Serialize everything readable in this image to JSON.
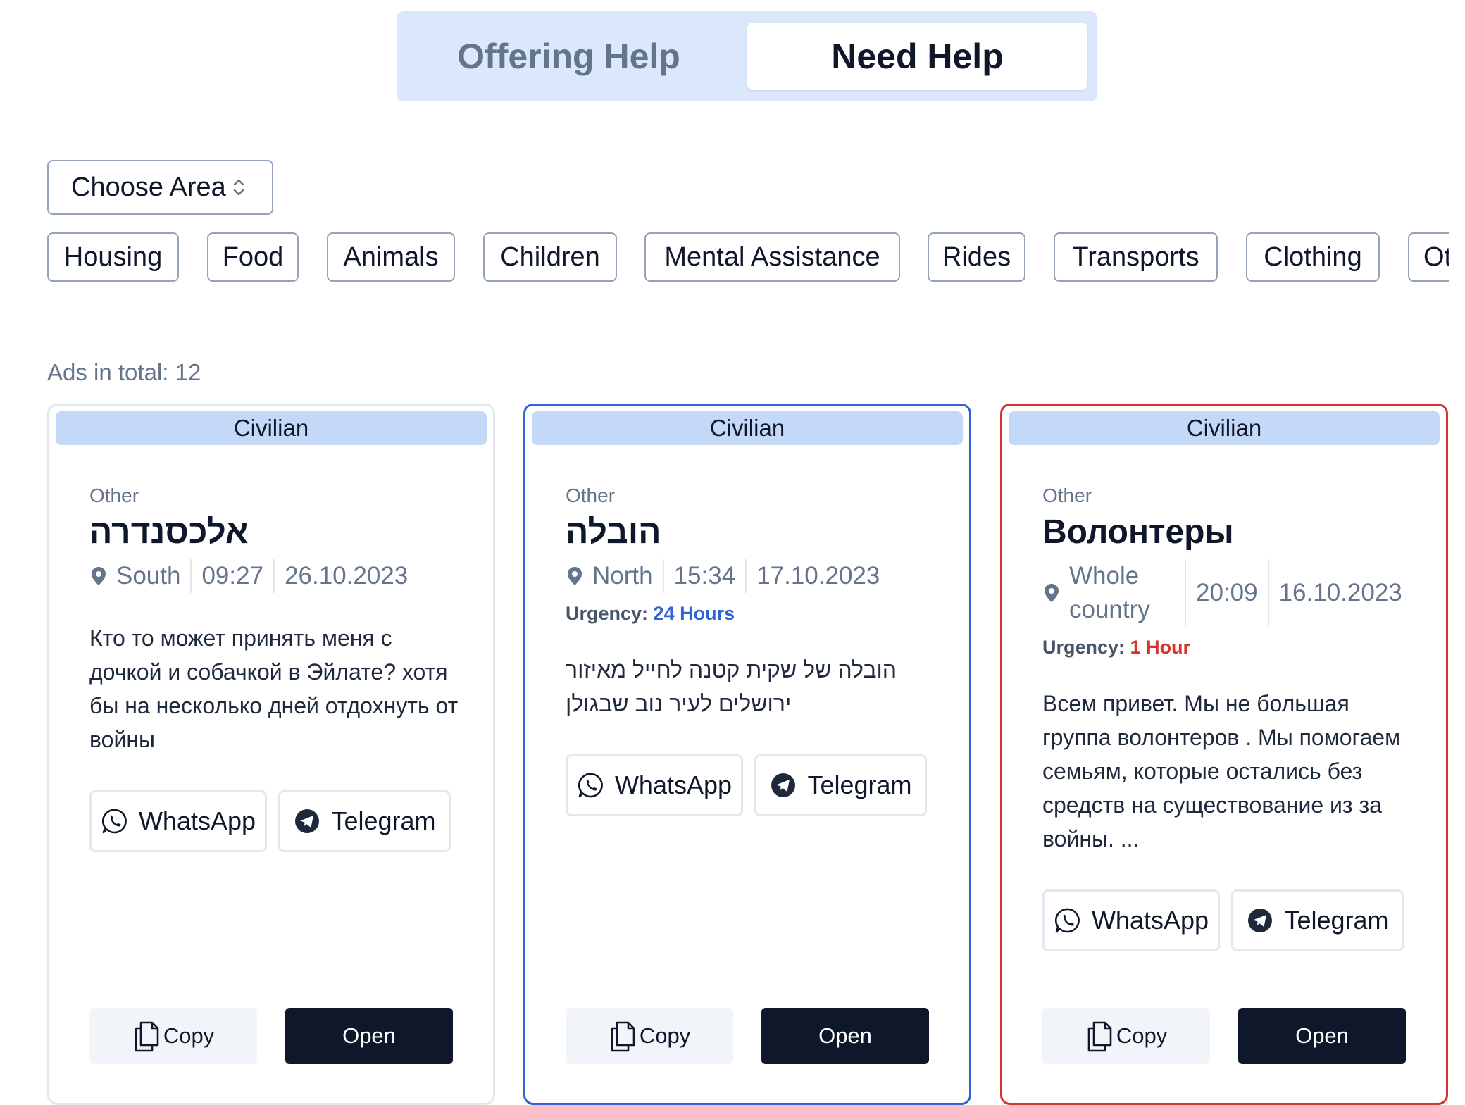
{
  "toggle": {
    "offering_label": "Offering Help",
    "need_label": "Need Help"
  },
  "area_select": {
    "label": "Choose Area"
  },
  "categories": [
    "Housing",
    "Food",
    "Animals",
    "Children",
    "Mental Assistance",
    "Rides",
    "Transports",
    "Clothing",
    "Ot"
  ],
  "ads_total": "Ads in total: 12",
  "cards": [
    {
      "type": "Civilian",
      "category": "Other",
      "title": "אלכסנדרה",
      "location": "South",
      "time": "09:27",
      "date": "26.10.2023",
      "urgency_label": "",
      "urgency_value": "",
      "description": "Кто то может принять меня с дочкой и собачкой в Эйлате? хотя бы на несколько дней отдохнуть от войны",
      "whatsapp": "WhatsApp",
      "telegram": "Telegram",
      "copy": "Copy",
      "open": "Open"
    },
    {
      "type": "Civilian",
      "category": "Other",
      "title": "הובלה",
      "location": "North",
      "time": "15:34",
      "date": "17.10.2023",
      "urgency_label": "Urgency:",
      "urgency_value": "24 Hours",
      "description": "הובלה של שקית קטנה לחייל מאיזור ירושלים לעיר נוב שבגולן",
      "whatsapp": "WhatsApp",
      "telegram": "Telegram",
      "copy": "Copy",
      "open": "Open"
    },
    {
      "type": "Civilian",
      "category": "Other",
      "title": "Волонтеры",
      "location": "Whole country",
      "time": "20:09",
      "date": "16.10.2023",
      "urgency_label": "Urgency:",
      "urgency_value": "1 Hour",
      "description": "Всем привет. Мы не большая группа волонтеров . Мы помогаем семьям, которые остались без средств на существование из за войны. ...",
      "whatsapp": "WhatsApp",
      "telegram": "Telegram",
      "copy": "Copy",
      "open": "Open"
    }
  ],
  "colors": {
    "accent_blue": "#3063d6",
    "accent_red": "#d6332e",
    "badge_bg": "#c4d9f8",
    "toggle_bg": "#dbe7fb",
    "primary_dark": "#0f172a"
  },
  "icons": [
    "chevron-updown-icon",
    "map-pin-icon",
    "whatsapp-icon",
    "telegram-icon",
    "copy-icon"
  ]
}
